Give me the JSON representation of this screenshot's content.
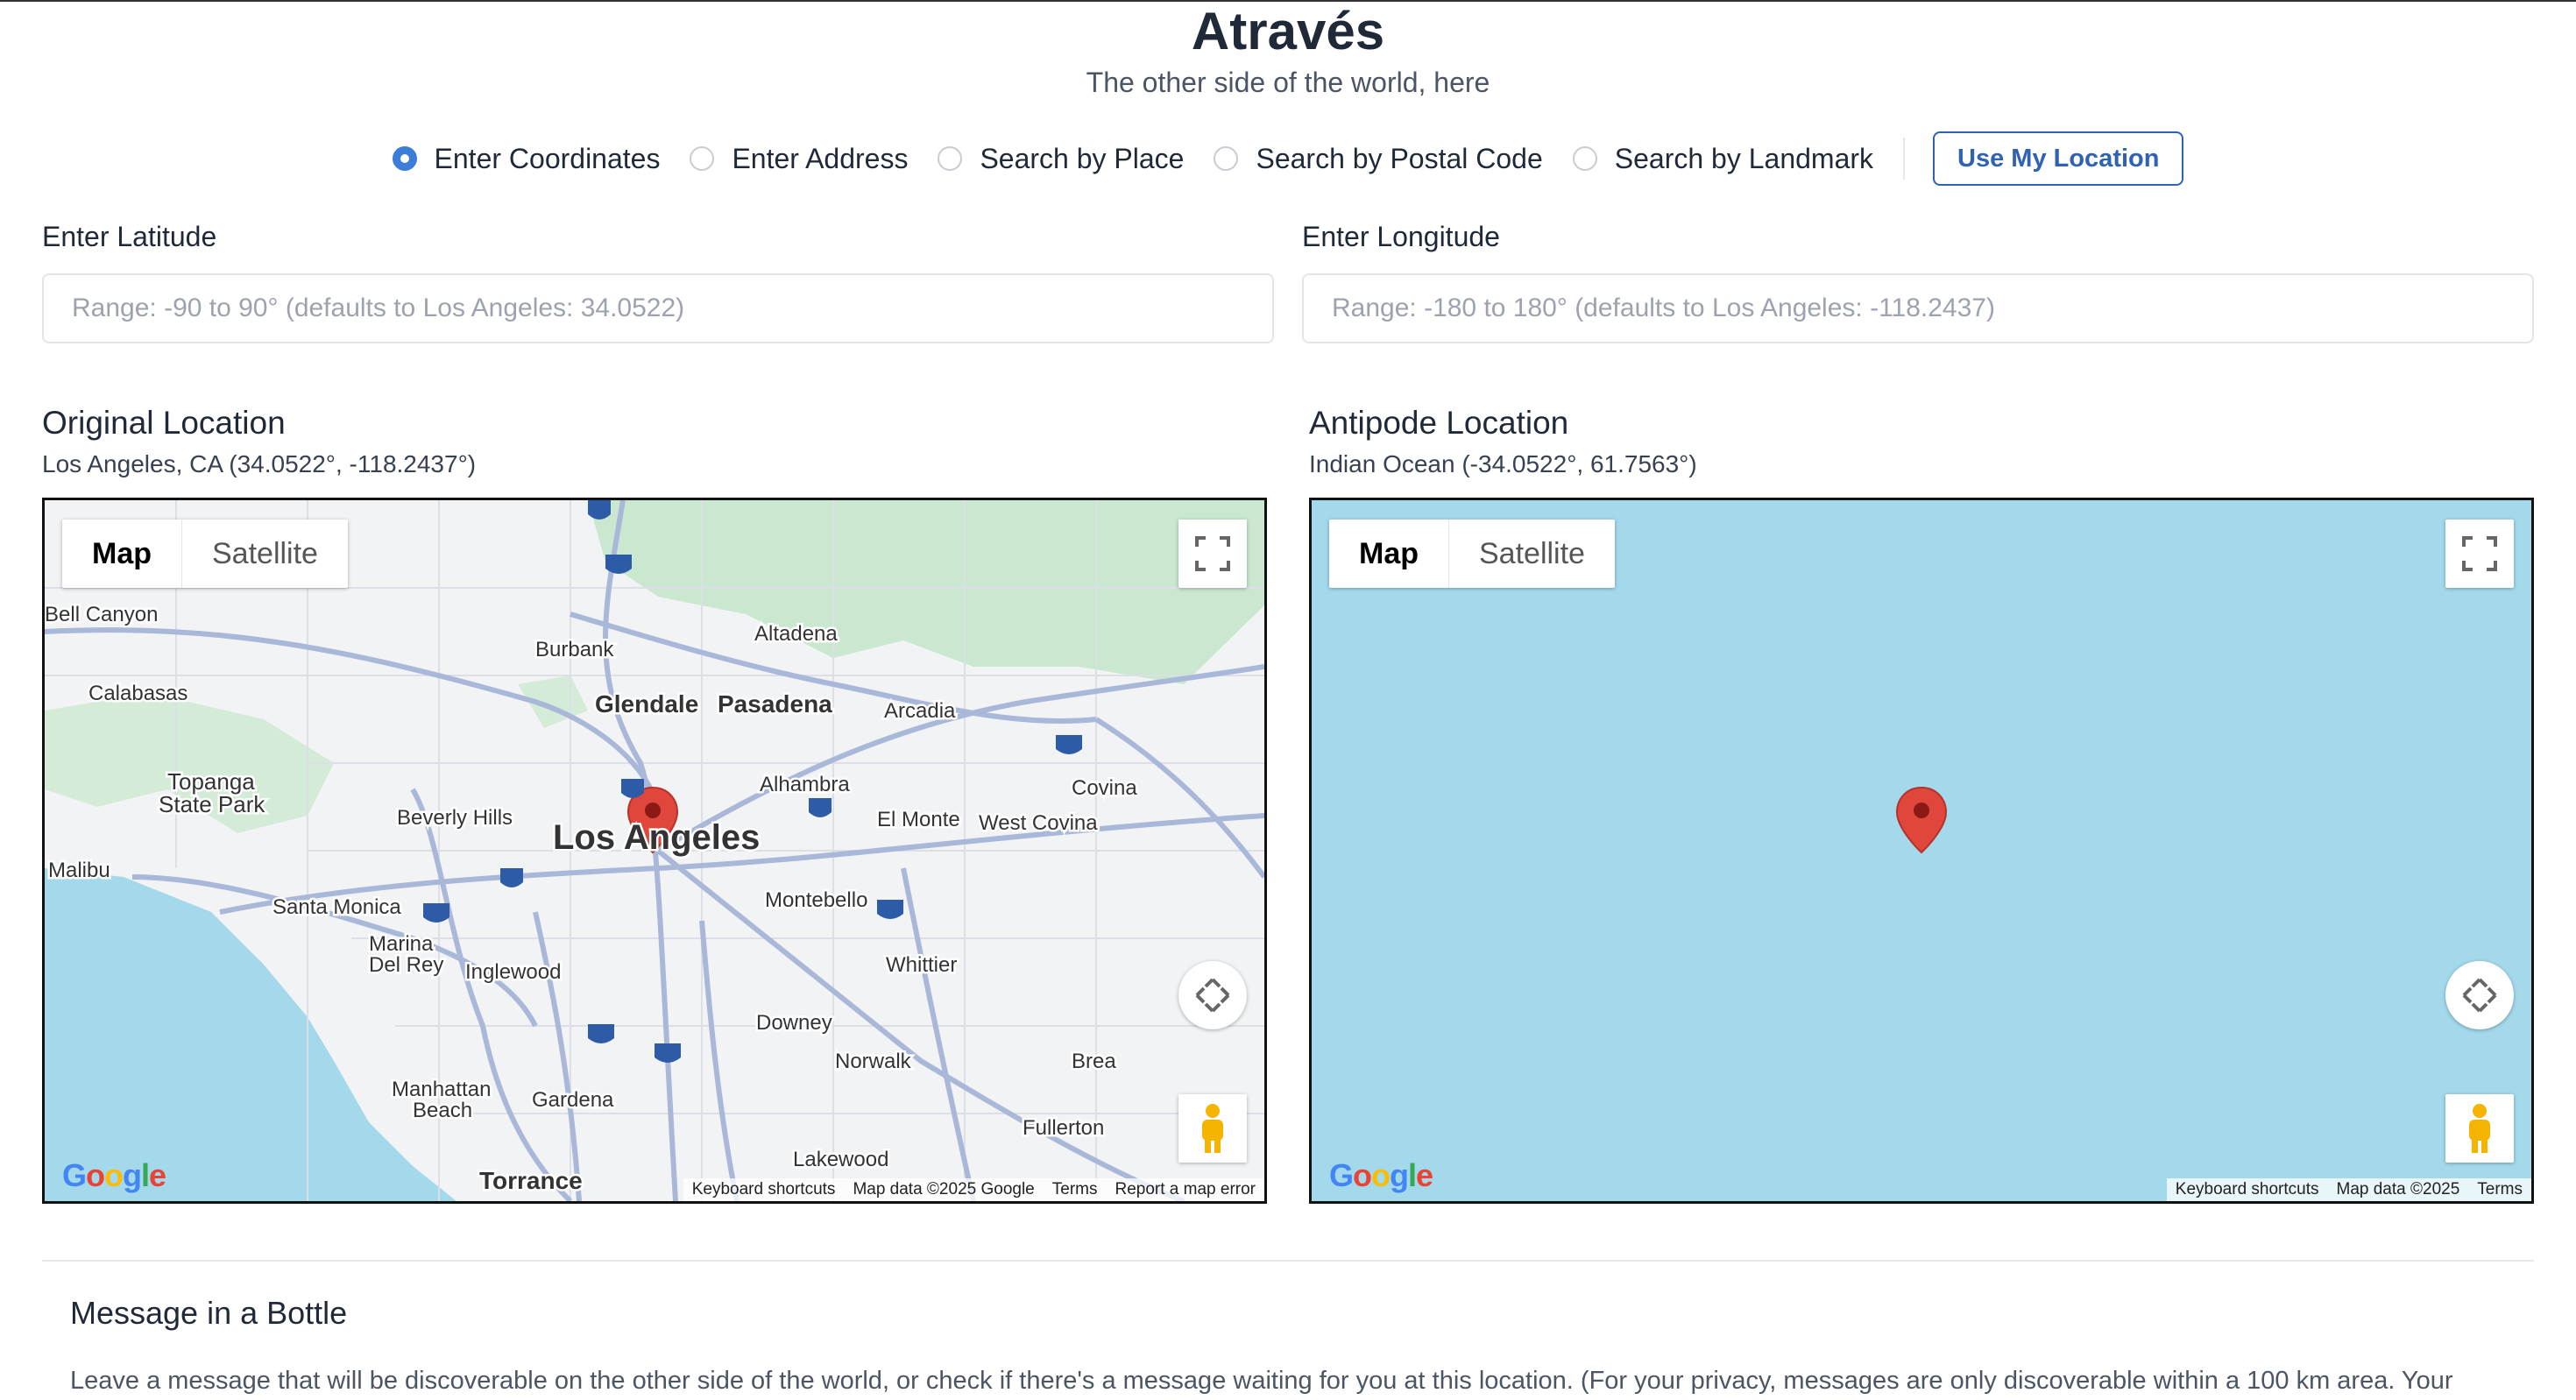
{
  "header": {
    "title": "Através",
    "subtitle": "The other side of the world, here"
  },
  "modes": [
    {
      "label": "Enter Coordinates",
      "selected": true
    },
    {
      "label": "Enter Address",
      "selected": false
    },
    {
      "label": "Search by Place",
      "selected": false
    },
    {
      "label": "Search by Postal Code",
      "selected": false
    },
    {
      "label": "Search by Landmark",
      "selected": false
    }
  ],
  "use_location_label": "Use My Location",
  "latitude": {
    "label": "Enter Latitude",
    "value": "",
    "placeholder": "Range: -90 to 90° (defaults to Los Angeles: 34.0522)"
  },
  "longitude": {
    "label": "Enter Longitude",
    "value": "",
    "placeholder": "Range: -180 to 180° (defaults to Los Angeles: -118.2437)"
  },
  "original": {
    "title": "Original Location",
    "subtitle": "Los Angeles, CA (34.0522°, -118.2437°)",
    "map_label": "Map",
    "satellite_label": "Satellite",
    "attribution": [
      "Keyboard shortcuts",
      "Map data ©2025 Google",
      "Terms",
      "Report a map error"
    ],
    "places": {
      "los_angeles": "Los Angeles",
      "glendale": "Glendale",
      "pasadena": "Pasadena",
      "burbank": "Burbank",
      "altadena": "Altadena",
      "arcadia": "Arcadia",
      "alhambra": "Alhambra",
      "el_monte": "El Monte",
      "west_covina": "West Covina",
      "covina": "Covina",
      "beverly_hills": "Beverly Hills",
      "santa_monica": "Santa Monica",
      "marina": "Marina",
      "del_rey": "Del Rey",
      "inglewood": "Inglewood",
      "montebello": "Montebello",
      "whittier": "Whittier",
      "downey": "Downey",
      "norwalk": "Norwalk",
      "brea": "Brea",
      "fullerton": "Fullerton",
      "lakewood": "Lakewood",
      "gardena": "Gardena",
      "torrance": "Torrance",
      "manhattan": "Manhattan",
      "beach": "Beach",
      "calabasas": "Calabasas",
      "bell_canyon": "Bell Canyon",
      "topanga": "Topanga",
      "state_park": "State Park",
      "malibu": "Malibu"
    }
  },
  "antipode": {
    "title": "Antipode Location",
    "subtitle": "Indian Ocean (-34.0522°, 61.7563°)",
    "map_label": "Map",
    "satellite_label": "Satellite",
    "attribution": [
      "Keyboard shortcuts",
      "Map data ©2025",
      "Terms"
    ]
  },
  "google_logo": "Google",
  "bottle": {
    "title": "Message in a Bottle",
    "text": "Leave a message that will be discoverable on the other side of the world, or check if there's a message waiting for you at this location. (For your privacy, messages are only discoverable within a 100 km area. Your"
  },
  "colors": {
    "accent": "#2f62b3",
    "radio_selected": "#3b7dd8",
    "ocean": "#a3d9eb",
    "land": "#f2f3f4",
    "park": "#c9e8cf",
    "marker": "#e0463b"
  }
}
